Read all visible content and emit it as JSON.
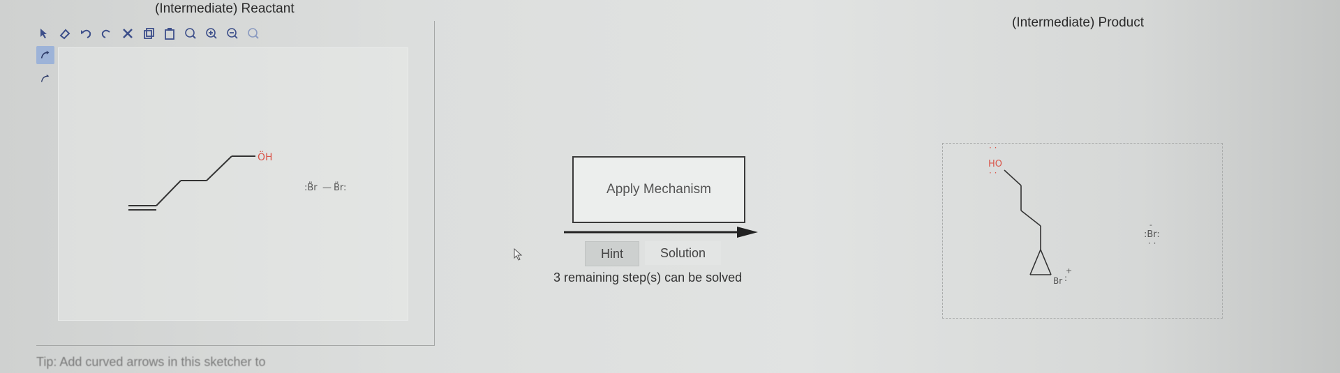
{
  "reactant_panel": {
    "title": "(Intermediate) Reactant",
    "toolbar_icons": [
      "pointer-icon",
      "eraser-icon",
      "undo-icon",
      "redo-icon",
      "delete-icon",
      "copy-icon",
      "paste-icon",
      "zoom-reset-icon",
      "zoom-in-icon",
      "zoom-out-icon",
      "zoom-fit-icon"
    ],
    "side_tools": [
      "curved-arrow-double-icon",
      "curved-arrow-single-icon"
    ],
    "molecule_1": {
      "atom_label": "ÖH"
    },
    "molecule_2": {
      "left_atom": ":B̈r",
      "right_atom": "B̈r:",
      "bond": "—"
    }
  },
  "product_panel": {
    "title": "(Intermediate) Product",
    "hydroxyl_label": "HO",
    "bromonium_label": "Br",
    "bromonium_charge": "+",
    "bromide_label": ":Br:",
    "bromide_charge": "-"
  },
  "mechanism": {
    "apply_label": "Apply Mechanism",
    "hint_label": "Hint",
    "solution_label": "Solution",
    "remaining_text": "3 remaining step(s) can be solved"
  },
  "footer": {
    "tip_text": "Tip: Add curved arrows in this sketcher to"
  },
  "colors": {
    "oxygen": "#d9554a",
    "bond": "#333333",
    "accent": "#3d4f8a",
    "lone_pair": "#333333"
  }
}
